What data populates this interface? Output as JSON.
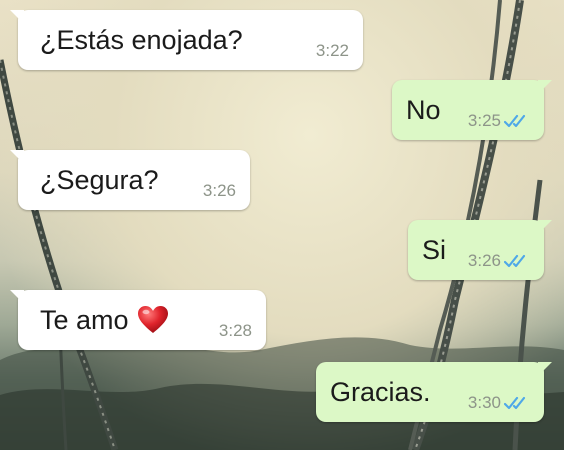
{
  "colors": {
    "incoming_bubble": "#ffffff",
    "outgoing_bubble": "#dcf8c6",
    "read_ticks": "#4fa8e8",
    "timestamp": "#8d9489",
    "heart": "#e0242c"
  },
  "messages": [
    {
      "direction": "incoming",
      "text": "¿Estás enojada?",
      "time": "3:22"
    },
    {
      "direction": "outgoing",
      "text": "No",
      "time": "3:25",
      "status_icon": "double-check-read-icon"
    },
    {
      "direction": "incoming",
      "text": "¿Segura?",
      "time": "3:26"
    },
    {
      "direction": "outgoing",
      "text": "Si",
      "time": "3:26",
      "status_icon": "double-check-read-icon"
    },
    {
      "direction": "incoming",
      "text": "Te amo",
      "emoji": "heart-icon",
      "time": "3:28"
    },
    {
      "direction": "outgoing",
      "text": "Gracias.",
      "time": "3:30",
      "status_icon": "double-check-read-icon"
    }
  ]
}
